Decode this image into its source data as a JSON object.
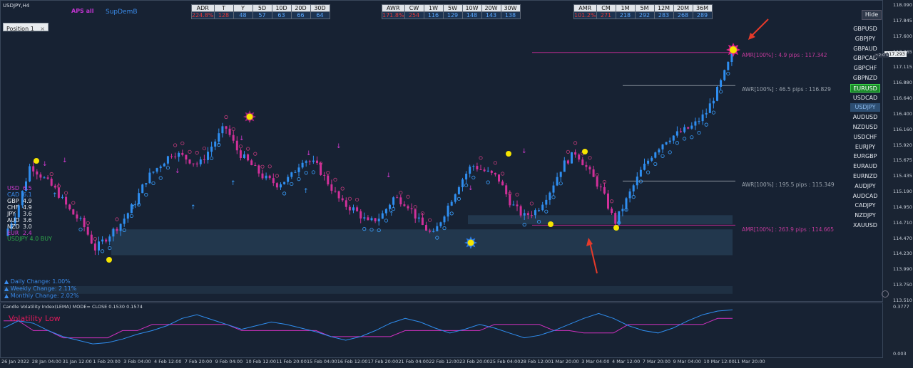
{
  "header": {
    "symbol": "USDJPY,H4",
    "brand_a": "APS all",
    "brand_b": "SupDemB",
    "position_label": "Position",
    "position_digit": "1",
    "close_glyph": "×",
    "hide_label": "Hide"
  },
  "stats_tables": [
    {
      "headers": [
        "ADR",
        "T",
        "Y",
        "5D",
        "10D",
        "20D",
        "30D"
      ],
      "values": [
        "224.8%",
        "128",
        "48",
        "57",
        "63",
        "66",
        "64"
      ],
      "red": [
        0,
        1
      ]
    },
    {
      "headers": [
        "AWR",
        "CW",
        "1W",
        "5W",
        "10W",
        "20W",
        "30W"
      ],
      "values": [
        "171.8%",
        "254",
        "116",
        "129",
        "148",
        "143",
        "138"
      ],
      "red": [
        0,
        1
      ]
    },
    {
      "headers": [
        "AMR",
        "CM",
        "1M",
        "5M",
        "12M",
        "20M",
        "36M"
      ],
      "values": [
        "101.2%",
        "271",
        "218",
        "292",
        "283",
        "268",
        "289"
      ],
      "red": [
        0,
        1
      ]
    }
  ],
  "pairs": [
    "GBPUSD",
    "GBPJPY",
    "GBPAUD",
    "GBPCAD",
    "GBPCHF",
    "GBPNZD",
    "EURUSD",
    "USDCAD",
    "USDJPY",
    "AUDUSD",
    "NZDUSD",
    "USDCHF",
    "EURJPY",
    "EURGBP",
    "EURAUD",
    "EURNZD",
    "AUDJPY",
    "AUDCAD",
    "CADJPY",
    "NZDJPY",
    "XAUUSD"
  ],
  "pair_highlight": {
    "green": "EURUSD",
    "blue": "USDJPY"
  },
  "currency_strength": [
    {
      "ccy": "USD",
      "val": "6.5",
      "color": "#d03ad0"
    },
    {
      "ccy": "CAD",
      "val": "6.1",
      "color": "#3a8ae8"
    },
    {
      "ccy": "GBP",
      "val": "4.9",
      "color": "#e8ecf2"
    },
    {
      "ccy": "CHF",
      "val": "4.9",
      "color": "#e8ecf2"
    },
    {
      "ccy": "JPY",
      "val": "3.6",
      "color": "#e8ecf2"
    },
    {
      "ccy": "AUD",
      "val": "3.6",
      "color": "#e8ecf2"
    },
    {
      "ccy": "NZD",
      "val": "3.0",
      "color": "#e8ecf2"
    },
    {
      "ccy": "EUR",
      "val": "2.4",
      "color": "#d03ad0"
    }
  ],
  "signal": "USDJPY 4.0 BUY",
  "changes": [
    "▲ Daily Change: 1.00%",
    "▲ Weekly Change: 2.11%",
    "▲ Monthly Change: 2.02%"
  ],
  "levels": [
    {
      "label": "AMR[100%] : 4.9 pips : 117.342",
      "color": "#c03a9a",
      "line_color": "#b02a8a"
    },
    {
      "label": "AWR[100%] : 46.5 pips : 116.829",
      "color": "#9aa3ad",
      "line_color": "#8a939d"
    },
    {
      "label": "AWR[100%] : 195.5 pips : 115.349",
      "color": "#9aa3ad",
      "line_color": "#8a939d"
    },
    {
      "label": "AMR[100%] : 263.9 pips : 114.665",
      "color": "#c03a9a",
      "line_color": "#b02a8a"
    }
  ],
  "price_tags": {
    "current": "117.293",
    "timer": "~2:0 s"
  },
  "indicator": {
    "title": "Candle Volatility Index(LEMA) MODE= CLOSE 0.1530 0.1574",
    "status": "Volatility Low",
    "ymax": "0.3777",
    "ymin": "0.003"
  },
  "chart_data": {
    "type": "candlestick",
    "symbol": "USDJPY",
    "timeframe": "H4",
    "y_ticks": [
      "118.090",
      "117.845",
      "117.600",
      "117.365",
      "117.115",
      "116.880",
      "116.640",
      "116.400",
      "116.160",
      "115.920",
      "115.675",
      "115.435",
      "115.190",
      "114.950",
      "114.710",
      "114.470",
      "114.230",
      "113.990",
      "113.750",
      "113.510"
    ],
    "x_ticks": [
      "26 Jan 2022",
      "28 Jan 04:00",
      "31 Jan 12:00",
      "1 Feb 20:00",
      "3 Feb 04:00",
      "4 Feb 12:00",
      "7 Feb 20:00",
      "9 Feb 04:00",
      "10 Feb 12:00",
      "11 Feb 20:00",
      "15 Feb 04:00",
      "16 Feb 12:00",
      "17 Feb 20:00",
      "21 Feb 04:00",
      "22 Feb 12:00",
      "23 Feb 20:00",
      "25 Feb 04:00",
      "28 Feb 12:00",
      "1 Mar 20:00",
      "3 Mar 04:00",
      "4 Mar 12:00",
      "7 Mar 20:00",
      "9 Mar 04:00",
      "10 Mar 12:00",
      "11 Mar 20:00"
    ],
    "close_path": [
      114.5,
      114.9,
      115.6,
      115.4,
      115.2,
      114.9,
      114.7,
      114.3,
      114.5,
      114.7,
      115.0,
      115.4,
      115.6,
      115.8,
      115.7,
      115.6,
      115.9,
      116.2,
      115.8,
      115.6,
      115.4,
      115.3,
      115.4,
      115.7,
      115.6,
      115.3,
      115.0,
      114.9,
      114.7,
      114.8,
      115.1,
      115.0,
      114.7,
      114.5,
      114.9,
      115.3,
      115.6,
      115.5,
      115.4,
      115.0,
      114.8,
      114.9,
      115.2,
      115.6,
      115.8,
      115.5,
      115.2,
      114.7,
      115.1,
      115.5,
      115.8,
      116.0,
      116.1,
      116.2,
      116.4,
      116.8,
      117.3
    ],
    "markers": {
      "yellow_dots": [
        115.55,
        114.12,
        115.65,
        114.75,
        115.7,
        114.75
      ],
      "star_high": 116.4,
      "star_low": 114.45,
      "star_last": 117.35
    },
    "zones": [
      "114.2-114.6",
      "113.6-113.7",
      "114.7-114.8"
    ],
    "volatility_series": {
      "blue": [
        0.22,
        0.28,
        0.26,
        0.2,
        0.15,
        0.12,
        0.09,
        0.1,
        0.13,
        0.17,
        0.2,
        0.24,
        0.3,
        0.33,
        0.29,
        0.25,
        0.21,
        0.24,
        0.27,
        0.25,
        0.22,
        0.19,
        0.15,
        0.12,
        0.15,
        0.2,
        0.26,
        0.3,
        0.27,
        0.22,
        0.18,
        0.21,
        0.25,
        0.22,
        0.18,
        0.14,
        0.16,
        0.2,
        0.25,
        0.3,
        0.34,
        0.3,
        0.24,
        0.2,
        0.18,
        0.22,
        0.28,
        0.33,
        0.36,
        0.37
      ],
      "magenta": [
        0.28,
        0.28,
        0.2,
        0.2,
        0.14,
        0.14,
        0.14,
        0.14,
        0.2,
        0.2,
        0.25,
        0.25,
        0.25,
        0.25,
        0.25,
        0.25,
        0.2,
        0.2,
        0.2,
        0.2,
        0.2,
        0.2,
        0.15,
        0.15,
        0.15,
        0.15,
        0.15,
        0.2,
        0.2,
        0.2,
        0.2,
        0.2,
        0.2,
        0.25,
        0.25,
        0.25,
        0.25,
        0.2,
        0.2,
        0.18,
        0.18,
        0.18,
        0.25,
        0.25,
        0.25,
        0.25,
        0.25,
        0.25,
        0.3,
        0.3
      ]
    }
  }
}
